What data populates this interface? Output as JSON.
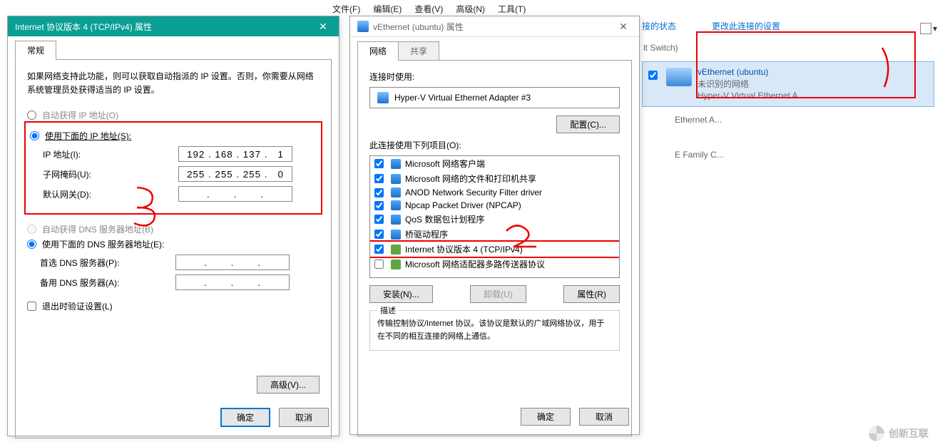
{
  "menubar": [
    "文件(F)",
    "编辑(E)",
    "查看(V)",
    "高级(N)",
    "工具(T)"
  ],
  "top_links": {
    "status": "接的状态",
    "change": "更改此连接的设置"
  },
  "side_items": [
    {
      "title": "lt Switch)",
      "sub": "",
      "adapter": ""
    },
    {
      "title": "",
      "sub": "",
      "adapter": "Ethernet A..."
    },
    {
      "title": "",
      "sub": "",
      "adapter": "E Family C..."
    }
  ],
  "selected_adapter": {
    "title": "vEthernet (ubuntu)",
    "sub": "未识别的网络",
    "adapter": "Hyper-V Virtual Ethernet A..."
  },
  "ipv4_dialog": {
    "title": "Internet 协议版本 4 (TCP/IPv4) 属性",
    "tab": "常规",
    "intro": "如果网络支持此功能，则可以获取自动指派的 IP 设置。否则，你需要从网络系统管理员处获得适当的 IP 设置。",
    "auto_ip": "自动获得 IP 地址(O)",
    "use_ip": "使用下面的 IP 地址(S):",
    "ip_label": "IP 地址(I):",
    "ip_val": "192 . 168 . 137 .   1",
    "mask_label": "子网掩码(U):",
    "mask_val": "255 . 255 . 255 .   0",
    "gw_label": "默认网关(D):",
    "gw_val": ".       .       .",
    "auto_dns": "自动获得 DNS 服务器地址(B)",
    "use_dns": "使用下面的 DNS 服务器地址(E):",
    "dns1_label": "首选 DNS 服务器(P):",
    "dns1_val": ".       .       .",
    "dns2_label": "备用 DNS 服务器(A):",
    "dns2_val": ".       .       .",
    "validate": "退出时验证设置(L)",
    "advanced": "高级(V)...",
    "ok": "确定",
    "cancel": "取消"
  },
  "props_dialog": {
    "title": "vEthernet (ubuntu) 属性",
    "tabs": {
      "net": "网络",
      "share": "共享"
    },
    "connect_using_label": "连接时使用:",
    "adapter": "Hyper-V Virtual Ethernet Adapter #3",
    "configure": "配置(C)...",
    "uses_items_label": "此连接使用下列项目(O):",
    "items": [
      {
        "checked": true,
        "label": "Microsoft 网络客户端"
      },
      {
        "checked": true,
        "label": "Microsoft 网络的文件和打印机共享"
      },
      {
        "checked": true,
        "label": "ANOD Network Security Filter driver"
      },
      {
        "checked": true,
        "label": "Npcap Packet Driver (NPCAP)"
      },
      {
        "checked": true,
        "label": "QoS 数据包计划程序"
      },
      {
        "checked": true,
        "label": "桥驱动程序"
      },
      {
        "checked": true,
        "label": "Internet 协议版本 4 (TCP/IPv4)",
        "highlighted": true,
        "green": true
      },
      {
        "checked": false,
        "label": "Microsoft 网络适配器多路传送器协议",
        "green": true
      }
    ],
    "install": "安装(N)...",
    "uninstall": "卸载(U)",
    "properties": "属性(R)",
    "desc_label": "描述",
    "desc": "传输控制协议/Internet 协议。该协议是默认的广域网络协议，用于在不同的相互连接的网络上通信。",
    "ok": "确定",
    "cancel": "取消"
  },
  "watermark": "创新互联"
}
